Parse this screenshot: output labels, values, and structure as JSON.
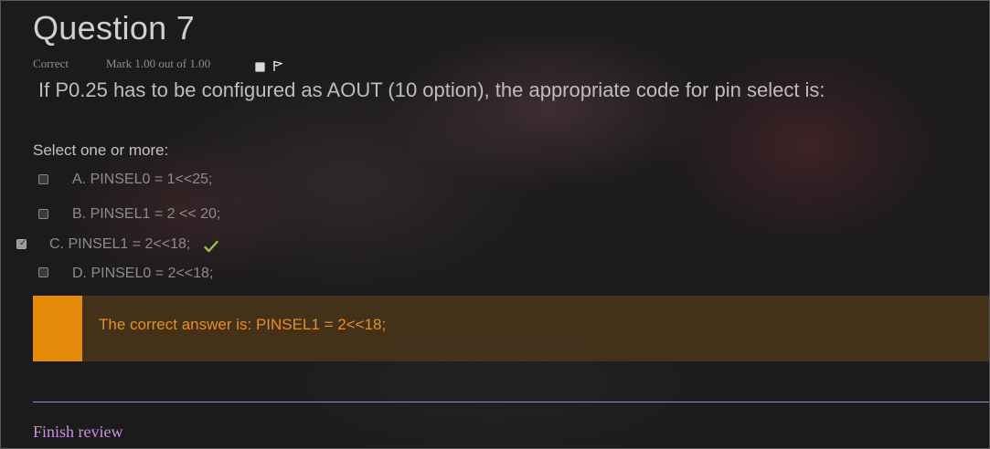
{
  "question": {
    "title": "Question 7",
    "status": "Correct",
    "mark": "Mark 1.00 out of 1.00",
    "flag_icon": "flag-icon",
    "text": "If P0.25 has to be configured as AOUT (10 option), the appropriate code for pin select is:"
  },
  "answer": {
    "prompt": "Select one or more:",
    "options": [
      {
        "label": "A. PINSEL0 = 1<<25;",
        "checked": false
      },
      {
        "label": "B. PINSEL1 = 2 << 20;",
        "checked": false
      },
      {
        "label": "C. PINSEL1 = 2<<18;",
        "checked": true,
        "correct": true
      },
      {
        "label": "D. PINSEL0 = 2<<18;",
        "checked": false
      }
    ]
  },
  "feedback": {
    "text": "The correct answer is: PINSEL1 = 2<<18;",
    "accent_color": "#e68a0a"
  },
  "footer": {
    "finish_label": "Finish review"
  }
}
